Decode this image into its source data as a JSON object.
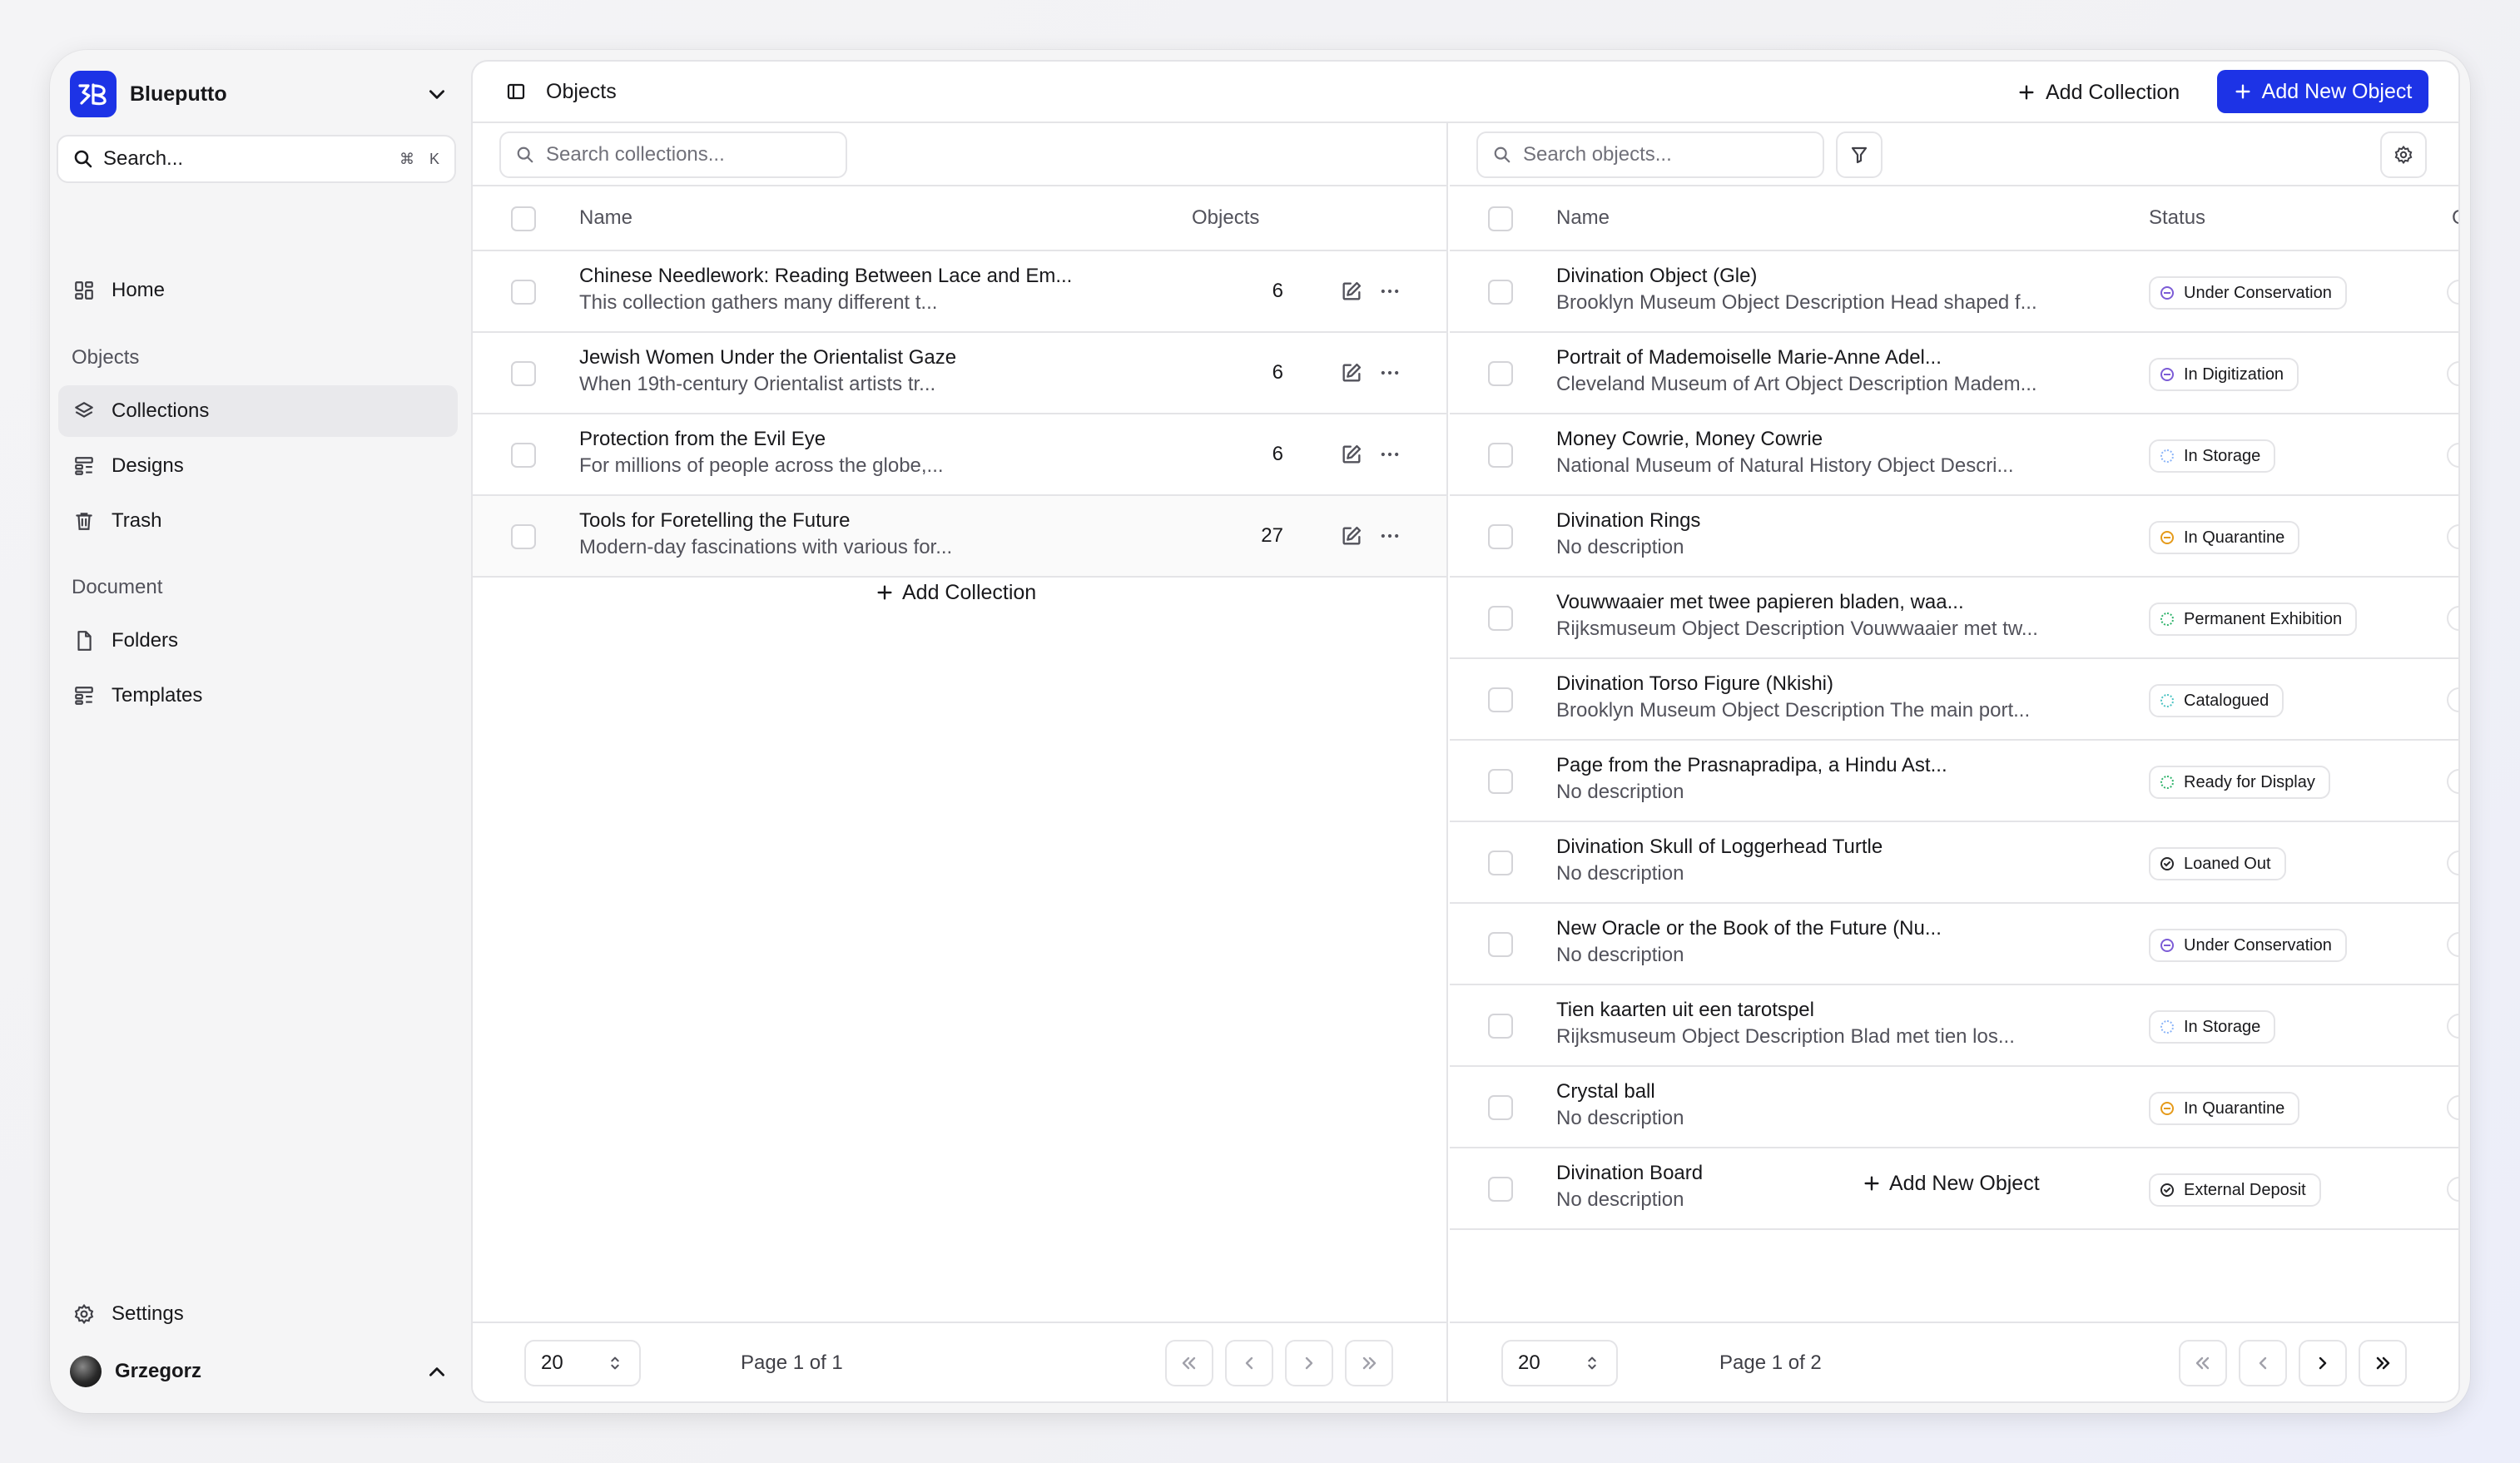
{
  "sidebar": {
    "brand": "Blueputto",
    "search_label": "Search...",
    "search_kbd_cmd": "⌘",
    "search_kbd_key": "K",
    "home": "Home",
    "section_objects": "Objects",
    "collections": "Collections",
    "designs": "Designs",
    "trash": "Trash",
    "section_document": "Document",
    "folders": "Folders",
    "templates": "Templates",
    "settings": "Settings",
    "user": "Grzegorz"
  },
  "topbar": {
    "title": "Objects",
    "add_collection": "Add Collection",
    "add_new_object": "Add New Object"
  },
  "collections": {
    "search_placeholder": "Search collections...",
    "col_name": "Name",
    "col_objects": "Objects",
    "rows": [
      {
        "name": "Chinese Needlework: Reading Between Lace and Em...",
        "desc": "This collection gathers many different t...",
        "count": "6"
      },
      {
        "name": "Jewish Women Under the Orientalist Gaze",
        "desc": "When 19th-century Orientalist artists tr...",
        "count": "6"
      },
      {
        "name": "Protection from the Evil Eye",
        "desc": "For millions of people across the globe,...",
        "count": "6"
      },
      {
        "name": "Tools for Foretelling the Future",
        "desc": "Modern-day fascinations with various for...",
        "count": "27"
      }
    ],
    "add_label": "Add Collection",
    "page_size": "20",
    "page_text": "Page 1 of 1"
  },
  "objects": {
    "search_placeholder": "Search objects...",
    "col_name": "Name",
    "col_status": "Status",
    "col_cut": "C",
    "rows": [
      {
        "name": "Divination Object (Gle)",
        "desc": "Brooklyn Museum Object Description Head shaped f...",
        "status": "Under Conservation",
        "color": "#7c5cd6"
      },
      {
        "name": "Portrait of Mademoiselle Marie-Anne Adel...",
        "desc": "Cleveland Museum of Art Object Description Madem...",
        "status": "In Digitization",
        "color": "#7c5cd6"
      },
      {
        "name": "Money Cowrie, Money Cowrie",
        "desc": "National Museum of Natural History Object Descri...",
        "status": "In Storage",
        "color": "#8ab4f8"
      },
      {
        "name": "Divination Rings",
        "desc": "No description",
        "status": "In Quarantine",
        "color": "#e59a1a"
      },
      {
        "name": "Vouwwaaier met twee papieren bladen, waa...",
        "desc": "Rijksmuseum Object Description Vouwwaaier met tw...",
        "status": "Permanent Exhibition",
        "color": "#2fb36b"
      },
      {
        "name": "Divination Torso Figure (Nkishi)",
        "desc": "Brooklyn Museum Object Description The main port...",
        "status": "Catalogued",
        "color": "#4cc3c3"
      },
      {
        "name": "Page from the Prasnapradipa, a Hindu Ast...",
        "desc": "No description",
        "status": "Ready for Display",
        "color": "#2fb36b"
      },
      {
        "name": "Divination Skull of Loggerhead Turtle",
        "desc": "No description",
        "status": "Loaned Out",
        "color": "#27272a"
      },
      {
        "name": "New Oracle or the Book of the Future (Nu...",
        "desc": "No description",
        "status": "Under Conservation",
        "color": "#7c5cd6"
      },
      {
        "name": "Tien kaarten uit een tarotspel",
        "desc": "Rijksmuseum Object Description Blad met tien los...",
        "status": "In Storage",
        "color": "#8ab4f8"
      },
      {
        "name": "Crystal ball",
        "desc": "No description",
        "status": "In Quarantine",
        "color": "#e59a1a"
      },
      {
        "name": "Divination Board",
        "desc": "No description",
        "status": "External Deposit",
        "color": "#27272a"
      }
    ],
    "add_label": "Add New Object",
    "page_size": "20",
    "page_text": "Page 1 of 2"
  }
}
